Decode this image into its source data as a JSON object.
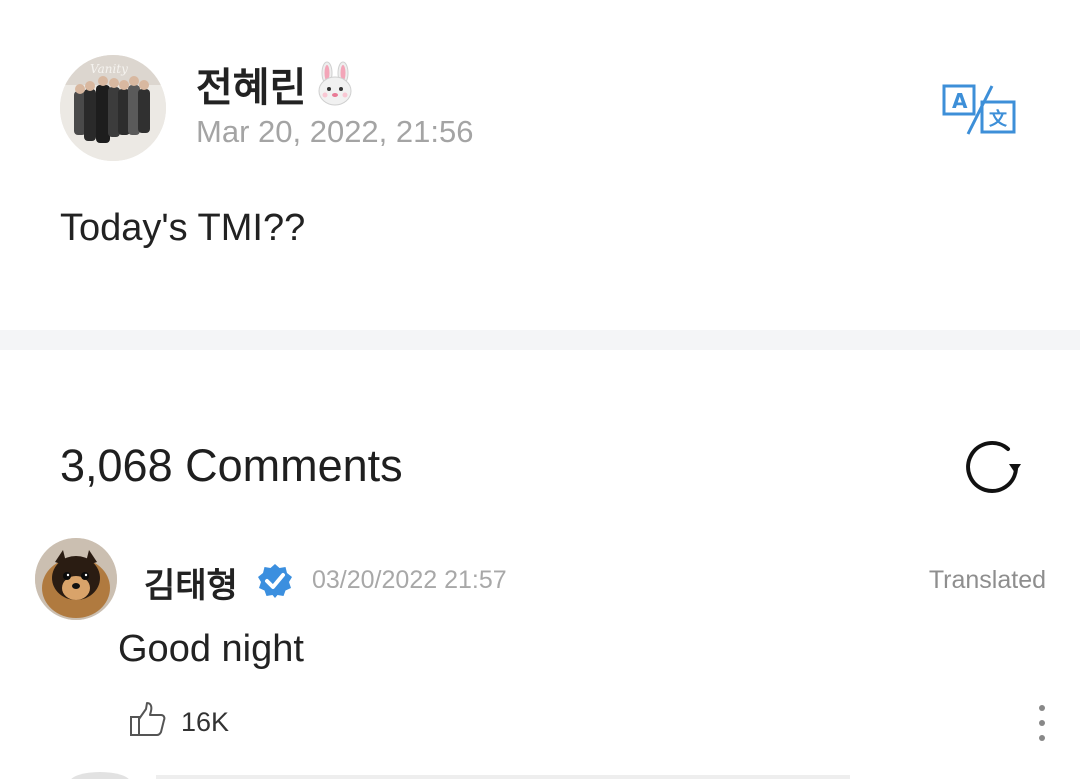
{
  "post": {
    "author": "전혜린",
    "author_emoji": "rabbit-face-icon",
    "date": "Mar 20, 2022, 21:56",
    "body": "Today's TMI??",
    "translate_icon": "translate-icon",
    "avatar": "group-photo-avatar"
  },
  "comments": {
    "count_label": "3,068 Comments",
    "refresh_icon": "refresh-icon",
    "items": [
      {
        "author": "김태형",
        "verified": true,
        "date": "03/20/2022 21:57",
        "translated_label": "Translated",
        "text": "Good night",
        "likes": "16K",
        "avatar": "dog-avatar"
      }
    ]
  },
  "colors": {
    "accent": "#3d8fd8",
    "verified": "#3b8fdf",
    "muted_text": "#a4a4a4",
    "divider": "#f4f5f7"
  }
}
